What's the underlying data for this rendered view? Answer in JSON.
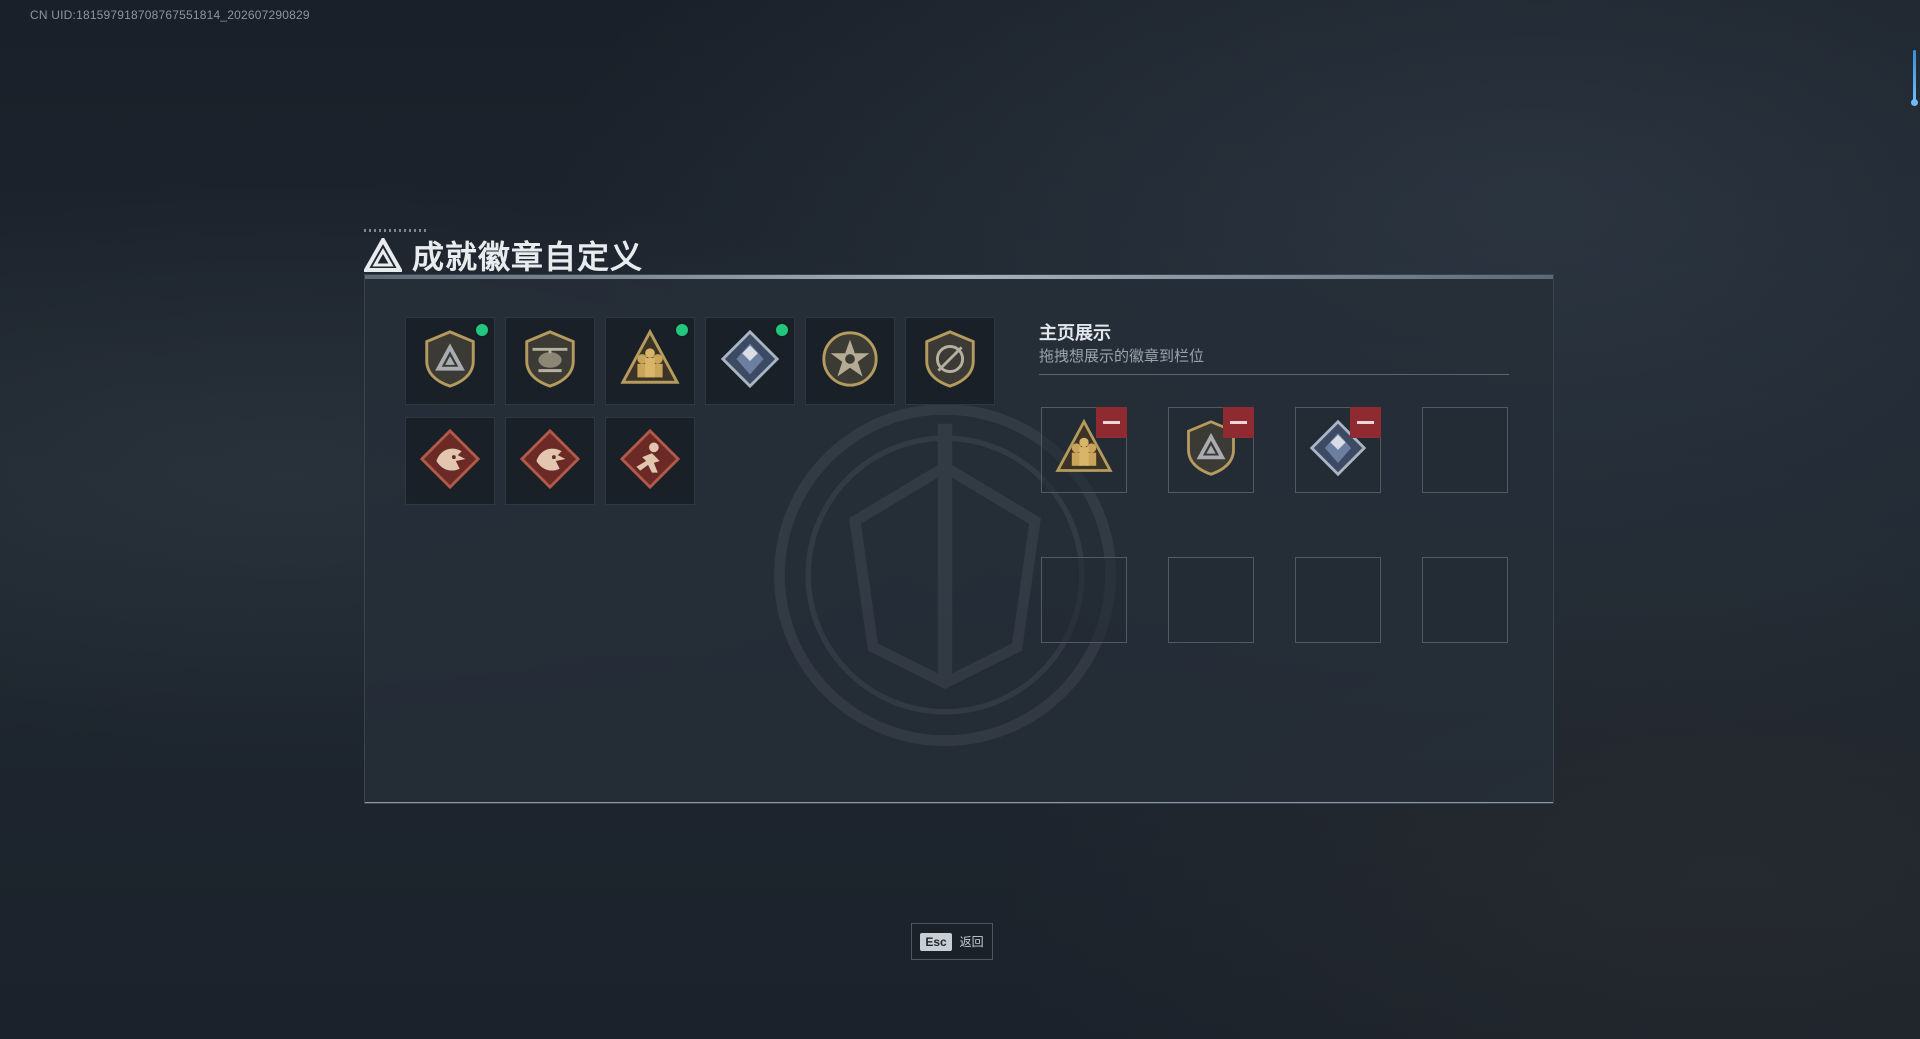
{
  "uid_text": "CN UID:1815979187087675518​14_202607290829",
  "title": "成就徽章自定义",
  "library": {
    "badges": [
      {
        "icon": "shield-triangle-badge-icon",
        "equipped": true
      },
      {
        "icon": "helicopter-shield-badge-icon",
        "equipped": false
      },
      {
        "icon": "soldiers-triangle-badge-icon",
        "equipped": true
      },
      {
        "icon": "crystal-diamond-badge-icon",
        "equipped": true
      },
      {
        "icon": "star-circle-badge-icon",
        "equipped": false
      },
      {
        "icon": "target-shield-badge-icon",
        "equipped": false
      },
      {
        "icon": "dragon-diamond-badge-icon",
        "equipped": false
      },
      {
        "icon": "dragon-diamond-badge-icon",
        "equipped": false
      },
      {
        "icon": "runner-diamond-badge-icon",
        "equipped": false
      }
    ]
  },
  "display": {
    "title": "主页展示",
    "subtitle": "拖拽想展示的徽章到栏位",
    "slots": [
      {
        "icon": "soldiers-triangle-badge-icon",
        "filled": true
      },
      {
        "icon": "shield-triangle-badge-icon",
        "filled": true
      },
      {
        "icon": "crystal-diamond-badge-icon",
        "filled": true
      },
      {
        "icon": "",
        "filled": false
      },
      {
        "icon": "",
        "filled": false
      },
      {
        "icon": "",
        "filled": false
      },
      {
        "icon": "",
        "filled": false
      },
      {
        "icon": "",
        "filled": false
      }
    ]
  },
  "esc": {
    "key": "Esc",
    "label": "返回"
  },
  "colors": {
    "equipped_dot": "#21c77d",
    "remove_button": "#8f2a30",
    "gold": "#b69b5e"
  }
}
